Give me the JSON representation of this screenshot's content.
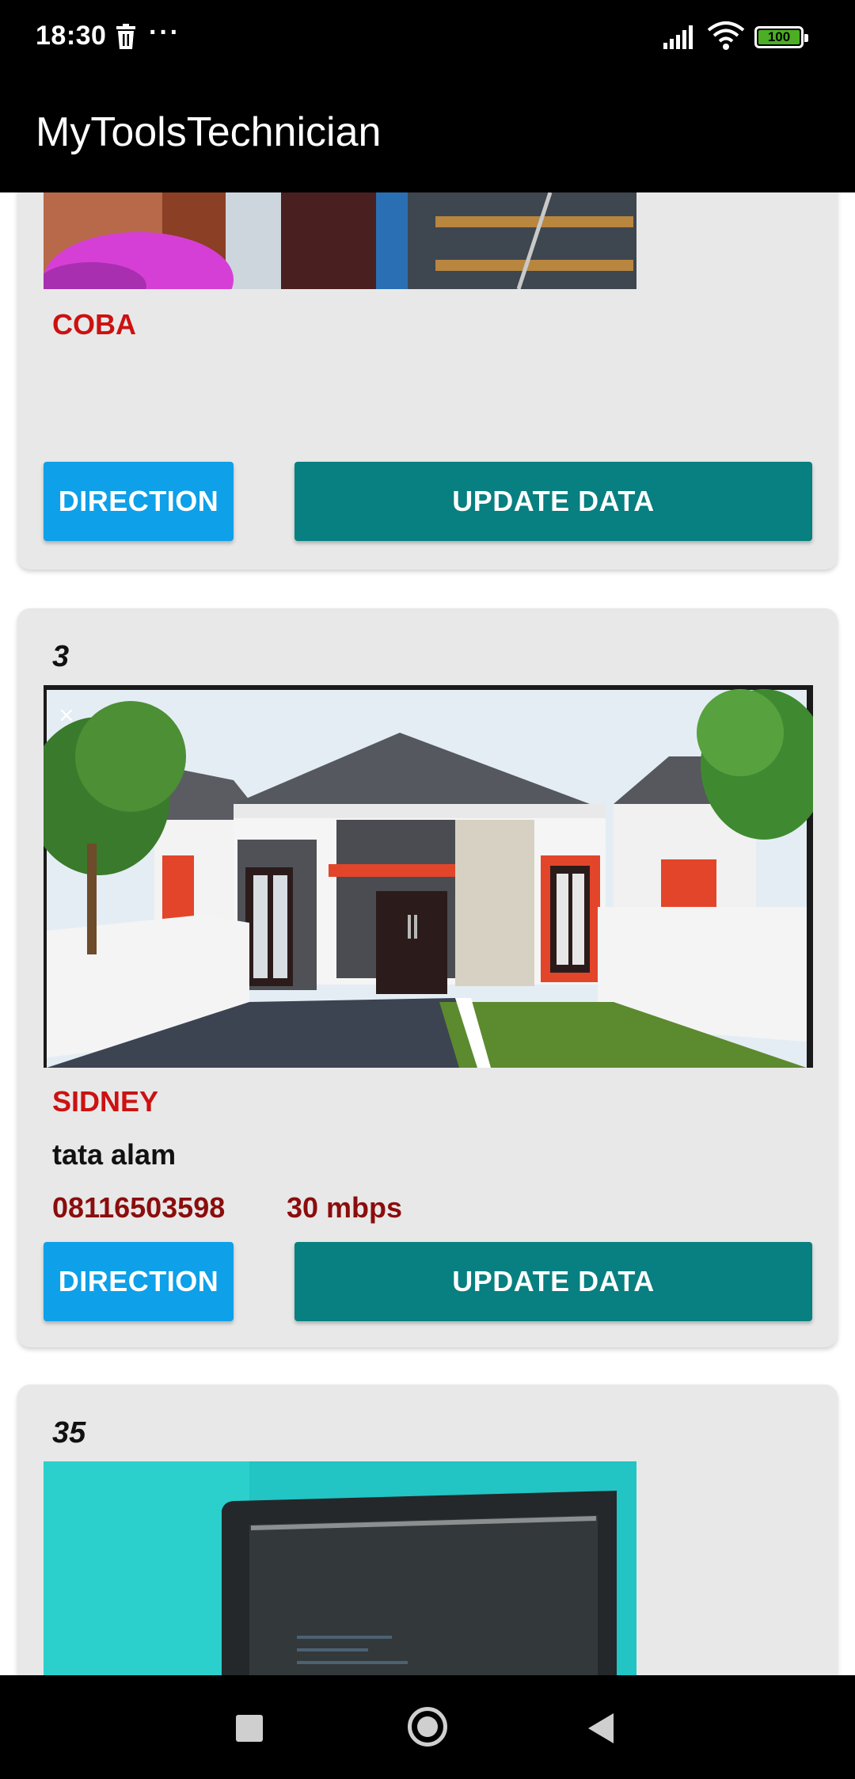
{
  "status_bar": {
    "time": "18:30",
    "more_indicator": "···",
    "battery_level": "100",
    "icons": [
      "trash-icon",
      "signal-icon",
      "wifi-icon",
      "battery-icon"
    ]
  },
  "app_bar": {
    "title": "MyToolsTechnician"
  },
  "cards": [
    {
      "name": "COBA",
      "direction_label": "DIRECTION",
      "update_label": "UPDATE DATA"
    },
    {
      "number": "3",
      "name": "SIDNEY",
      "address": "tata alam",
      "phone": "08116503598",
      "speed": "30 mbps",
      "direction_label": "DIRECTION",
      "update_label": "UPDATE DATA"
    },
    {
      "number": "35"
    }
  ],
  "colors": {
    "name": "#cc1111",
    "phone": "#8b0d0d",
    "direction_button": "#0ea0e8",
    "update_button": "#087f80",
    "card_background": "#e8e8e8"
  },
  "nav_bar": {
    "icons": [
      "recent-apps-icon",
      "home-icon",
      "back-icon"
    ]
  }
}
